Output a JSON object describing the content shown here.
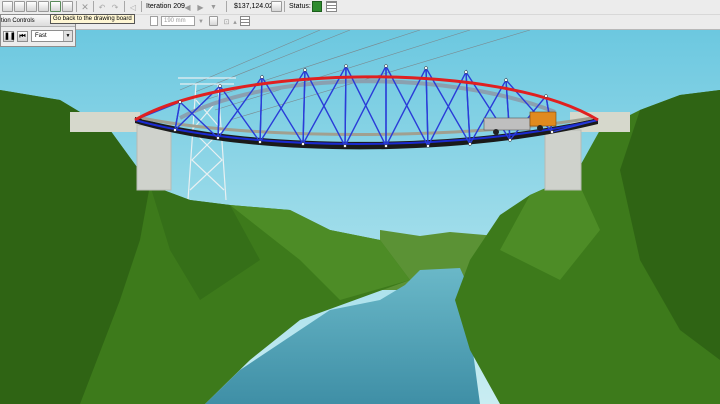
{
  "toolbar": {
    "iteration_label": "Iteration 209",
    "cost_value": "$137,124.02",
    "status_label": "Status:",
    "member_size_value": "190 mm"
  },
  "tooltip": {
    "text": "Go back to the drawing board"
  },
  "animation_controls": {
    "title": "tion Controls",
    "speed_value": "Fast"
  },
  "colors": {
    "compression_member": "#e02020",
    "tension_member": "#2a3cd8",
    "sky": "#87d4e6",
    "hill": "#3f7d1c",
    "river": "#4fa3b8"
  },
  "icons": {
    "pause": "pause-icon",
    "rewind": "rewind-icon",
    "status": "status-ok-icon",
    "grid": "grid-icon"
  }
}
